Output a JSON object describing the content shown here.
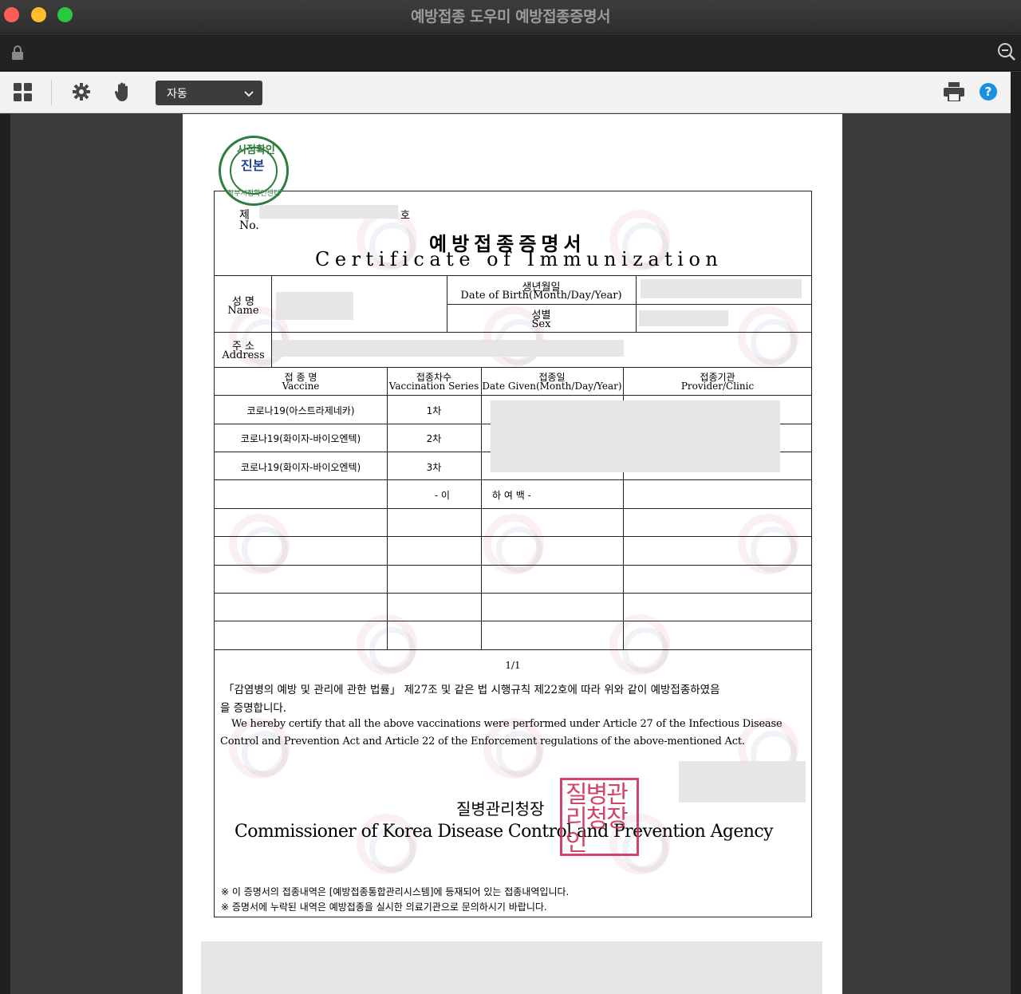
{
  "window": {
    "title": "예방접종 도우미 예방접종증명서"
  },
  "toolbar": {
    "zoom_value": "자동"
  },
  "certificate": {
    "no_ko": "제",
    "no_en": "No.",
    "no_suffix": "호",
    "title_ko": "예방접종증명서",
    "title_en": "Certificate of Immunization",
    "name_ko": "성  명",
    "name_en": "Name",
    "dob_ko": "생년월일",
    "dob_en": "Date of Birth(Month/Day/Year)",
    "sex_ko": "성별",
    "sex_en": "Sex",
    "address_ko": "주  소",
    "address_en": "Address",
    "columns": [
      {
        "ko": "접 종 명",
        "en": "Vaccine"
      },
      {
        "ko": "접종차수",
        "en": "Vaccination Series"
      },
      {
        "ko": "접종일",
        "en": "Date Given(Month/Day/Year)"
      },
      {
        "ko": "접종기관",
        "en": "Provider/Clinic"
      }
    ],
    "rows": [
      {
        "vaccine": "코로나19(아스트라제네카)",
        "series": "1차"
      },
      {
        "vaccine": "코로나19(화이자-바이오엔텍)",
        "series": "2차"
      },
      {
        "vaccine": "코로나19(화이자-바이오엔텍)",
        "series": "3차"
      }
    ],
    "blank_marker_1": "-   이",
    "blank_marker_2": "하     여     백   -",
    "page_number": "1/1",
    "statement_ko_1": "「감염병의 예방 및 관리에 관한 법률」 제27조 및 같은 법 시행규칙 제22호에 따라 위와 같이 예방접종하였음",
    "statement_ko_2": "을 증명합니다.",
    "statement_en_1": "We hereby certify that all the above vaccinations were performed under Article 27 of the Infectious Disease",
    "statement_en_2": "Control and Prevention Act and Article 22 of the Enforcement regulations of the above-mentioned Act.",
    "issuer_ko": "질병관리청장",
    "issuer_en": "Commissioner of Korea Disease Control and Prevention Agency",
    "note_1": "※ 이 증명서의 접종내역은 [예방접종통합관리시스템]에 등재되어 있는 접종내역입니다.",
    "note_2": "※ 증명서에 누락된 내역은 예방접종을 실시한 의료기관으로 문의하시기 바랍니다.",
    "stamp_text": "시점확인",
    "stamp_center": "진본",
    "stamp_bottom": "정부시점확인센터",
    "seal_text": "질병관리청장인"
  },
  "icons": {
    "lock": "lock-icon",
    "zoom_out": "zoom-out-icon",
    "thumbnails": "grid-icon",
    "settings": "gear-icon",
    "pan": "hand-icon",
    "print": "printer-icon",
    "help": "help-icon"
  }
}
